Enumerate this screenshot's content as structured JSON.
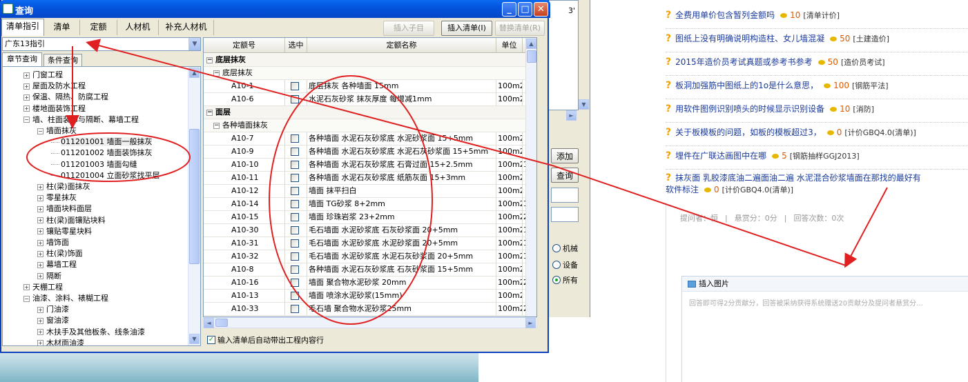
{
  "window": {
    "title": "查询",
    "minimize": "_",
    "maximize": "□",
    "close": "✕"
  },
  "tabs": [
    "清单指引",
    "清单",
    "定额",
    "人材机",
    "补充人材机"
  ],
  "toolbar": {
    "insert_child": "插入子目",
    "insert_list": "插入清单(I)",
    "replace_list": "替换清单(R)"
  },
  "region_select": "广东13指引",
  "subtabs": [
    "章节查询",
    "条件查询"
  ],
  "tree": [
    {
      "label": "门窗工程",
      "box": "+",
      "level": 1
    },
    {
      "label": "屋面及防水工程",
      "box": "+",
      "level": 1
    },
    {
      "label": "保温、隔热、防腐工程",
      "box": "+",
      "level": 1
    },
    {
      "label": "楼地面装饰工程",
      "box": "+",
      "level": 1
    },
    {
      "label": "墙、柱面装饰与隔断、幕墙工程",
      "box": "−",
      "level": 1
    },
    {
      "label": "墙面抹灰",
      "box": "−",
      "level": 2
    },
    {
      "label": "011201001  墙面一般抹灰",
      "box": "",
      "level": 3
    },
    {
      "label": "011201002  墙面装饰抹灰",
      "box": "",
      "level": 3
    },
    {
      "label": "011201003  墙面勾缝",
      "box": "",
      "level": 3
    },
    {
      "label": "011201004  立面砂浆找平层",
      "box": "",
      "level": 3
    },
    {
      "label": "柱(梁)面抹灰",
      "box": "+",
      "level": 2
    },
    {
      "label": "零星抹灰",
      "box": "+",
      "level": 2
    },
    {
      "label": "墙面块料面层",
      "box": "+",
      "level": 2
    },
    {
      "label": "柱(梁)面镶贴块料",
      "box": "+",
      "level": 2
    },
    {
      "label": "镶贴零星块料",
      "box": "+",
      "level": 2
    },
    {
      "label": "墙饰面",
      "box": "+",
      "level": 2
    },
    {
      "label": "柱(梁)饰面",
      "box": "+",
      "level": 2
    },
    {
      "label": "幕墙工程",
      "box": "+",
      "level": 2
    },
    {
      "label": "隔断",
      "box": "+",
      "level": 2
    },
    {
      "label": "天棚工程",
      "box": "+",
      "level": 1
    },
    {
      "label": "油漆、涂料、裱糊工程",
      "box": "−",
      "level": 1
    },
    {
      "label": "门油漆",
      "box": "+",
      "level": 2
    },
    {
      "label": "窗油漆",
      "box": "+",
      "level": 2
    },
    {
      "label": "木扶手及其他板条、线条油漆",
      "box": "+",
      "level": 2
    },
    {
      "label": "木材面油漆",
      "box": "+",
      "level": 2
    }
  ],
  "grid": {
    "headers": [
      "定额号",
      "选中",
      "定额名称",
      "单位"
    ],
    "rows": [
      {
        "type": "grp",
        "label": "底层抹灰"
      },
      {
        "type": "sub",
        "label": "底层抹灰"
      },
      {
        "type": "row",
        "code": "A10-1",
        "name": "底层抹灰 各种墙面 15mm",
        "unit": "100m2",
        "extra": ""
      },
      {
        "type": "row",
        "code": "A10-6",
        "name": "水泥石灰砂浆 抹灰厚度 每增减1mm",
        "unit": "100m2",
        "extra": ""
      },
      {
        "type": "grp",
        "label": "面层"
      },
      {
        "type": "sub",
        "label": "各种墙面抹灰"
      },
      {
        "type": "row",
        "code": "A10-7",
        "name": "各种墙面 水泥石灰砂浆底 水泥砂浆面 15+5mm",
        "unit": "100m2",
        "extra": ""
      },
      {
        "type": "row",
        "code": "A10-9",
        "name": "各种墙面 水泥石灰砂浆底 水泥石灰砂浆面 15+5mm",
        "unit": "100m2",
        "extra": ""
      },
      {
        "type": "row",
        "code": "A10-10",
        "name": "各种墙面 水泥石灰砂浆底 石膏过面 15+2.5mm",
        "unit": "100m2",
        "extra": "1"
      },
      {
        "type": "row",
        "code": "A10-11",
        "name": "各种墙面 水泥石灰砂浆底 纸筋灰面 15+3mm",
        "unit": "100m2",
        "extra": ""
      },
      {
        "type": "row",
        "code": "A10-12",
        "name": "墙面 抹平扫白",
        "unit": "100m2",
        "extra": ""
      },
      {
        "type": "row",
        "code": "A10-14",
        "name": "墙面 TG砂浆 8+2mm",
        "unit": "100m2",
        "extra": "1"
      },
      {
        "type": "row",
        "code": "A10-15",
        "name": "墙面 珍珠岩浆 23+2mm",
        "unit": "100m2",
        "extra": "2"
      },
      {
        "type": "row",
        "code": "A10-30",
        "name": "毛石墙面 水泥砂浆底 石灰砂浆面 20+5mm",
        "unit": "100m2",
        "extra": "1"
      },
      {
        "type": "row",
        "code": "A10-31",
        "name": "毛石墙面 水泥砂浆底 水泥砂浆面 20+5mm",
        "unit": "100m2",
        "extra": "1"
      },
      {
        "type": "row",
        "code": "A10-32",
        "name": "毛石墙面 水泥砂浆底 水泥石灰砂浆面 20+5mm",
        "unit": "100m2",
        "extra": "1"
      },
      {
        "type": "row",
        "code": "A10-8",
        "name": "各种墙面 水泥石灰砂浆底 石灰砂浆面 15+5mm",
        "unit": "100m2",
        "extra": ""
      },
      {
        "type": "row",
        "code": "A10-16",
        "name": "墙面 聚合物水泥砂浆 20mm",
        "unit": "100m2",
        "extra": "2"
      },
      {
        "type": "row",
        "code": "A10-13",
        "name": "墙面 喷涂水泥砂浆(15mm)",
        "unit": "100m2",
        "extra": ""
      },
      {
        "type": "row",
        "code": "A10-33",
        "name": "毛石墙 聚合物水泥砂浆25mm",
        "unit": "100m2",
        "extra": "2"
      }
    ]
  },
  "footer_checkbox": "输入清单后自动带出工程内容行",
  "background_app": {
    "add_button": "添加",
    "query_button": "查询",
    "radios": [
      "机械",
      "设备",
      "所有"
    ],
    "top_value": "3'"
  },
  "qa_list": [
    {
      "title": "全费用单价包含暂列金额吗",
      "points": "10",
      "tag": "[清单计价]"
    },
    {
      "title": "图纸上没有明确说明构造柱、女儿墙混凝",
      "points": "50",
      "tag": "[土建造价]"
    },
    {
      "title": "2015年造价员考试真题或参考书参考",
      "points": "50",
      "tag": "[造价员考试]"
    },
    {
      "title": "板洞加强筋中图纸上的1o是什么意思，",
      "points": "100",
      "tag": "[钢筋平法]"
    },
    {
      "title": "用软件图例识别喷头的时候显示识别设备",
      "points": "10",
      "tag": "[消防]"
    },
    {
      "title": "关于板模板的问题，如板的模板超过3，",
      "points": "0",
      "tag": "[计价GBQ4.0(清单)]"
    },
    {
      "title": "埋件在广联达画图中在哪",
      "points": "5",
      "tag": "[钢筋抽样GGJ2013]"
    }
  ],
  "qa_last": {
    "title": "抹灰面 乳胶漆底油二遍面油二遍 水泥混合砂浆墙面在那找的最好有",
    "title2": "软件标注",
    "points": "0",
    "tag": "[计价GBQ4.0(清单)]"
  },
  "question_meta": {
    "asker": "提问者：恒",
    "reward": "悬赏分：0分",
    "answers": "回答次数：0次"
  },
  "answer_box": {
    "insert_image": "插入图片",
    "placeholder": "回答即可得2分贡献分，回答被采纳获得系统赠送20贡献分及提问者悬赏分..."
  },
  "colors": {
    "titlebar": "#0554de",
    "annotation": "#e02020",
    "link": "#1a3a9c",
    "points": "#e05a00"
  }
}
